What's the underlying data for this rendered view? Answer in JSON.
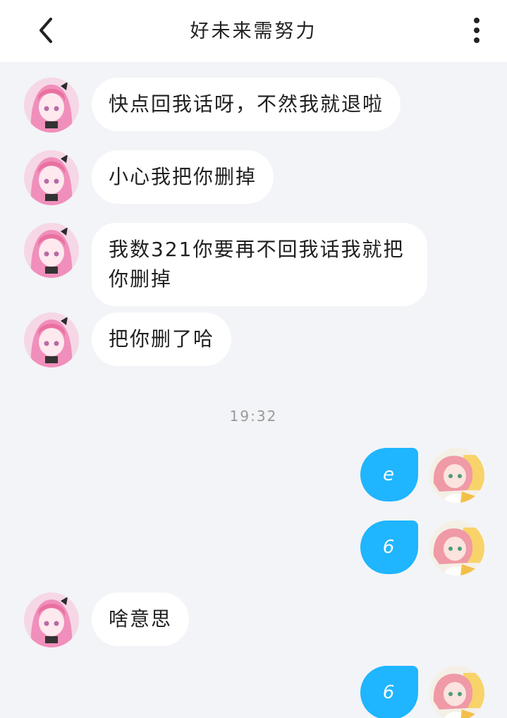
{
  "header": {
    "title": "好未来需努力"
  },
  "messages": [
    {
      "side": "in",
      "text": "快点回我话呀，不然我就退啦"
    },
    {
      "side": "in",
      "text": "小心我把你删掉"
    },
    {
      "side": "in",
      "text": "我数321你要再不回我话我就把你删掉"
    },
    {
      "side": "in",
      "text": "把你删了哈"
    },
    {
      "side": "out",
      "text": "e"
    },
    {
      "side": "out",
      "text": "6"
    },
    {
      "side": "in",
      "text": "啥意思"
    },
    {
      "side": "out",
      "text": "6"
    }
  ],
  "timestamp": "19:32",
  "colors": {
    "outgoing_bubble": "#1fb5ff",
    "incoming_bubble": "#ffffff",
    "background": "#f3f4f7"
  }
}
